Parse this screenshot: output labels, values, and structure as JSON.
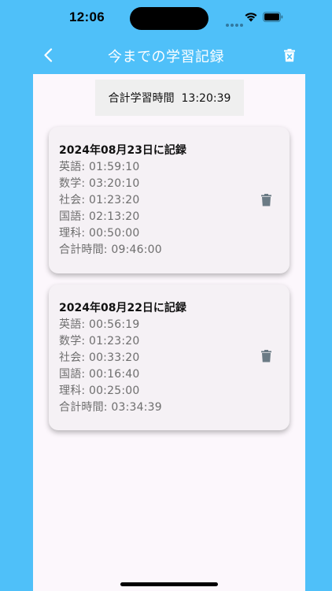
{
  "status_bar": {
    "time": "12:06"
  },
  "app_bar": {
    "title": "今までの学習記録"
  },
  "summary": {
    "total_label": "合計学習時間  13:20:39"
  },
  "records": [
    {
      "title": "2024年08月23日に記録",
      "rows": [
        "英語: 01:59:10",
        "数学: 03:20:10",
        "社会: 01:23:20",
        "国語: 02:13:20",
        "理科: 00:50:00",
        "合計時間: 09:46:00"
      ]
    },
    {
      "title": "2024年08月22日に記録",
      "rows": [
        "英語: 00:56:19",
        "数学: 01:23:20",
        "社会: 00:33:20",
        "国語: 00:16:40",
        "理科: 00:25:00",
        "合計時間: 03:34:39"
      ]
    }
  ],
  "icons": {
    "back": "chevron-left-icon",
    "delete_all": "trash-x-icon",
    "record_delete": "trash-icon"
  },
  "colors": {
    "app_bar": "#4fc0f9",
    "sheet": "#fcf7fc",
    "card": "#f5f1f5",
    "icon_gray": "#6b7b85"
  }
}
